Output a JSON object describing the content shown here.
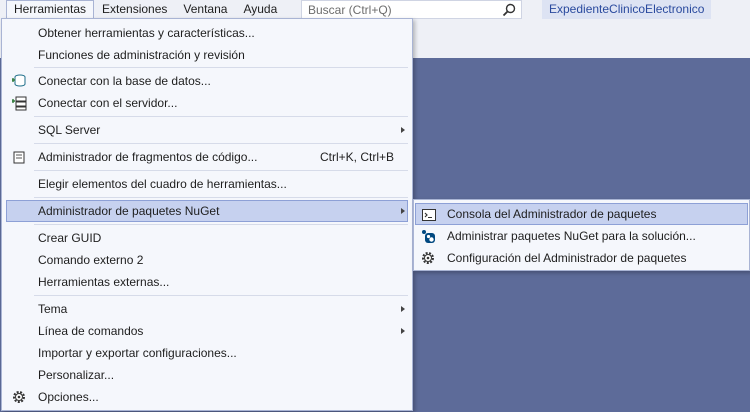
{
  "menubar": {
    "items": [
      "Herramientas",
      "Extensiones",
      "Ventana",
      "Ayuda"
    ],
    "search_placeholder": "Buscar (Ctrl+Q)",
    "project_name": "ExpedienteClinicoElectronico"
  },
  "tools_menu": {
    "items": [
      {
        "label": "Obtener herramientas y características..."
      },
      {
        "label": "Funciones de administración y revisión"
      },
      {
        "label": "Conectar con la base de datos...",
        "icon": "database-connect-icon"
      },
      {
        "label": "Conectar con el servidor...",
        "icon": "server-connect-icon"
      },
      {
        "label": "SQL Server",
        "submenu": true
      },
      {
        "label": "Administrador de fragmentos de código...",
        "shortcut": "Ctrl+K, Ctrl+B",
        "icon": "snippet-icon"
      },
      {
        "label": "Elegir elementos del cuadro de herramientas..."
      },
      {
        "label": "Administrador de paquetes NuGet",
        "submenu": true,
        "highlighted": true
      },
      {
        "label": "Crear GUID"
      },
      {
        "label": "Comando externo 2"
      },
      {
        "label": "Herramientas externas..."
      },
      {
        "label": "Tema",
        "submenu": true
      },
      {
        "label": "Línea de comandos",
        "submenu": true
      },
      {
        "label": "Importar y exportar configuraciones..."
      },
      {
        "label": "Personalizar..."
      },
      {
        "label": "Opciones...",
        "icon": "gear-icon"
      }
    ]
  },
  "nuget_submenu": {
    "items": [
      {
        "label": "Consola del Administrador de paquetes",
        "icon": "console-icon",
        "highlighted": true
      },
      {
        "label": "Administrar paquetes NuGet para la solución...",
        "icon": "nuget-icon"
      },
      {
        "label": "Configuración del Administrador de paquetes",
        "icon": "gear-icon"
      }
    ]
  }
}
